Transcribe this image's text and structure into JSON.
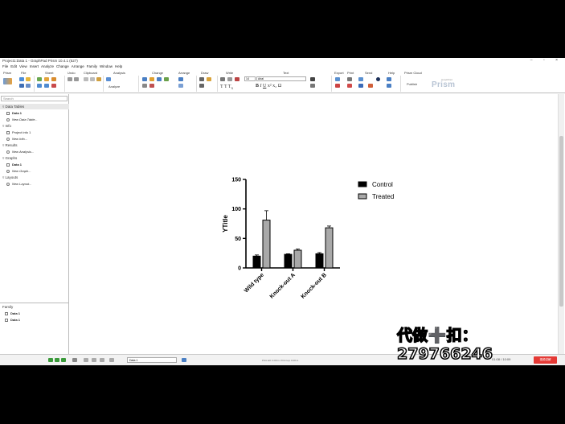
{
  "window": {
    "title": "Project1:Data 1 - GraphPad Prism 10.4.1 (527)",
    "controls": "– ▫ ×"
  },
  "menu": [
    "File",
    "Edit",
    "View",
    "Insert",
    "Analyze",
    "Change",
    "Arrange",
    "Family",
    "Window",
    "Help"
  ],
  "ribbon_groups": [
    "Prism",
    "File",
    "Sheet",
    "Undo",
    "Clipboard",
    "Analysis",
    "Change",
    "Arrange",
    "Draw",
    "Write",
    "Text",
    "Export",
    "Print",
    "Send",
    "Help",
    "Prism Cloud"
  ],
  "ribbon": {
    "analyze_label": "Analyze",
    "font_size": "14",
    "font_name": "Arial",
    "publish_label": "Publish",
    "logo": "Prism"
  },
  "navigator": {
    "search_placeholder": "Search",
    "sections": [
      {
        "label": "Data Tables",
        "items": [
          {
            "label": "Data 1",
            "style": "bold"
          },
          {
            "label": "New Data Table...",
            "style": "italic"
          }
        ]
      },
      {
        "label": "Info",
        "items": [
          {
            "label": "Project info 1",
            "style": "normal"
          },
          {
            "label": "New Info...",
            "style": "italic"
          }
        ]
      },
      {
        "label": "Results",
        "items": [
          {
            "label": "New Analysis...",
            "style": "italic"
          }
        ]
      },
      {
        "label": "Graphs",
        "items": [
          {
            "label": "Data 1",
            "style": "bold"
          },
          {
            "label": "New Graph...",
            "style": "italic"
          }
        ]
      },
      {
        "label": "Layouts",
        "items": [
          {
            "label": "New Layout...",
            "style": "italic"
          }
        ]
      }
    ],
    "family": {
      "label": "Family",
      "items": [
        "Data 1",
        "Data 1"
      ]
    }
  },
  "status": {
    "sheet_select": "Data 1",
    "page_info": "Print left: 0.00 in.  Print top: 0.00 in.",
    "time": "01:08 / 10:09",
    "red_button": "视频讲解"
  },
  "watermark": "代做➕扣：279766246",
  "colors": {
    "red_button": "#e53935",
    "control_bar": "#000000",
    "treated_bar": "#a9a9a9"
  },
  "chart_data": {
    "type": "bar",
    "categories": [
      "Wild type",
      "Knock-out A",
      "Knock-out B"
    ],
    "series": [
      {
        "name": "Control",
        "values": [
          20,
          23,
          24
        ],
        "errors": [
          2,
          1,
          2
        ]
      },
      {
        "name": "Treated",
        "values": [
          81,
          30,
          68
        ],
        "errors": [
          16,
          2,
          3
        ]
      }
    ],
    "ylabel": "YTitle",
    "xlabel": "",
    "ylim": [
      0,
      150
    ],
    "yticks": [
      0,
      50,
      100,
      150
    ],
    "legend": "right"
  }
}
